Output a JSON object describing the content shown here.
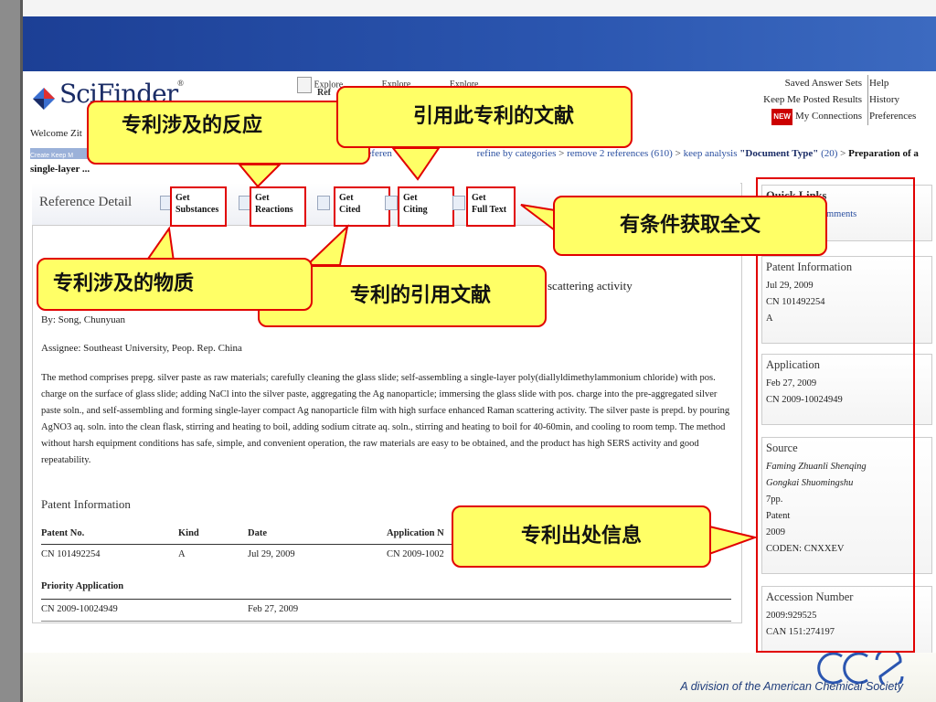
{
  "footer": {
    "division_text": "A division of the American Chemical Society"
  },
  "scifinder": {
    "logo_text": "SciFinder",
    "logo_reg": "®",
    "explore_links": [
      "Explore",
      "Explore",
      "Explore"
    ],
    "explore_sub": "Ref",
    "nav": {
      "saved_answer_sets": "Saved Answer Sets",
      "keep_me_posted": "Keep Me Posted Results",
      "new_badge": "NEW",
      "my_connections": "My Connections",
      "help": "Help",
      "history": "History",
      "preferences": "Preferences"
    },
    "welcome": "Welcome Zit",
    "create_keep": "Create Keep M",
    "breadcrumb": {
      "prefix": "referen",
      "refine": "refine by categories",
      "remove": "remove 2 references (610)",
      "keep_analysis": "keep analysis",
      "doc_type": "\"Document Type\"",
      "doc_count": "(20)",
      "current": "Preparation of a single-layer ..."
    },
    "reference_detail_title": "Reference Detail",
    "get_buttons": [
      {
        "line1": "Get",
        "line2": "Substances"
      },
      {
        "line1": "Get",
        "line2": "Reactions"
      },
      {
        "line1": "Get",
        "line2": "Cited"
      },
      {
        "line1": "Get",
        "line2": "Citing"
      },
      {
        "line1": "Get",
        "line2": "Full Text"
      }
    ],
    "title_fragment": "scattering activity",
    "byline": "By: Song, Chunyuan",
    "assignee": "Assignee: Southeast University, Peop. Rep. China",
    "abstract": "The method comprises prepg. silver paste as raw materials; carefully cleaning the glass slide; self-assembling a single-layer poly(diallyldimethylammonium chloride) with pos. charge on the surface of glass slide; adding NaCl into the silver paste, aggregating the Ag nanoparticle; immersing the glass slide with pos. charge into the pre-aggregated silver paste soln., and self-assembling and forming single-layer compact Ag nanoparticle film with high surface enhanced Raman scattering activity.  The silver paste is prepd. by pouring AgNO3 aq. soln. into the clean flask, stirring and heating to boil, adding sodium citrate aq. soln., stirring and heating to boil for 40-60min, and cooling to room temp.  The method without harsh equipment conditions has safe, simple, and convenient operation, the raw materials are easy to be obtained, and the product has high SERS activity and good repeatability.",
    "patent_info_heading": "Patent Information",
    "patent_table": {
      "headers": [
        "Patent No.",
        "Kind",
        "Date",
        "Application N"
      ],
      "row": [
        "CN 101492254",
        "A",
        "Jul 29, 2009",
        "CN 2009-1002"
      ]
    },
    "priority": {
      "heading": "Priority Application",
      "row": [
        "CN 2009-10024949",
        "Feb 27, 2009"
      ]
    },
    "right_column": {
      "quick_links_fragment": "Quick Links",
      "comments_fragment": "mments",
      "patent_information": {
        "title": "Patent Information",
        "lines": [
          "Jul 29, 2009",
          "CN 101492254",
          "A"
        ]
      },
      "application": {
        "title": "Application",
        "lines": [
          "Feb 27, 2009",
          "CN 2009-10024949"
        ]
      },
      "source": {
        "title": "Source",
        "lines": [
          "Faming Zhuanli Shenqing",
          "Gongkai Shuomingshu",
          "7pp.",
          "Patent",
          "2009",
          "CODEN: CNXXEV"
        ]
      },
      "accession_number": {
        "title": "Accession Number",
        "lines": [
          "2009:929525",
          "CAN 151:274197"
        ]
      }
    }
  },
  "callouts": {
    "reactions": "专利涉及的反应",
    "citing": "引用此专利的文献",
    "full_text": "有条件获取全文",
    "substances": "专利涉及的物质",
    "cited": "专利的引用文献",
    "source": "专利出处信息"
  },
  "colors": {
    "callout_fill": "#ffff66",
    "callout_border": "#e10000",
    "band_blue": "#2b56b0"
  }
}
